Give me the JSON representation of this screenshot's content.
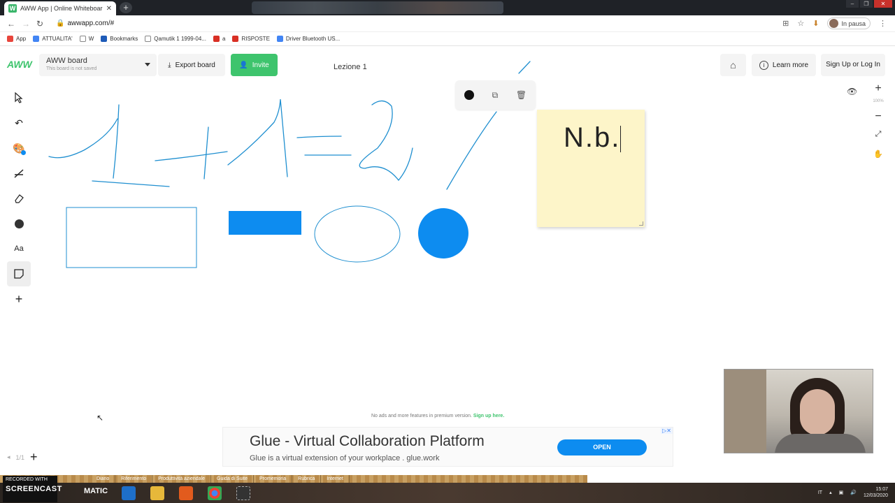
{
  "browser": {
    "tab_title": "AWW App | Online Whiteboard f",
    "url": "awwapp.com/#",
    "profile_label": "In pausa",
    "bookmarks": [
      {
        "label": "App",
        "color": "#e8453c"
      },
      {
        "label": "ATTUALITA'",
        "color": "#4285f4"
      },
      {
        "label": "W",
        "color": "#ffffff"
      },
      {
        "label": "Bookmarks",
        "color": "#1e5bb8"
      },
      {
        "label": "Qamutik 1 1999-04...",
        "color": "#ffffff"
      },
      {
        "label": "a",
        "color": "#d93025"
      },
      {
        "label": "RISPOSTE",
        "color": "#d93025"
      },
      {
        "label": "Driver Bluetooth US...",
        "color": "#4285f4"
      }
    ]
  },
  "header": {
    "logo": "AWW",
    "board_name": "AWW board",
    "board_status": "This board is not saved",
    "export_label": "Export board",
    "invite_label": "Invite",
    "board_title": "Lezione 1",
    "learn_more_label": "Learn more",
    "signup_label": "Sign Up or Log In"
  },
  "toolbar": {
    "text_tool": "Aa"
  },
  "zoom": {
    "level": "100%"
  },
  "sticky_note": {
    "text": "N.b."
  },
  "pager": {
    "label": "1/1"
  },
  "premium": {
    "text": "No ads and more features in premium version.",
    "link": "Sign up here."
  },
  "ad": {
    "headline": "Glue - Virtual Collaboration Platform",
    "subtext": "Glue is a virtual extension of your workplace . glue.work",
    "cta": "OPEN"
  },
  "taskbar": {
    "recorded_label": "RECORDED WITH",
    "screencast_label": "SCREENCAST",
    "matic_label": "MATIC",
    "strip_items": [
      "Diario",
      "Riferimento",
      "Produttività aziendale",
      "Guida di Suite",
      "Promemoria",
      "Rubrica",
      "Internet"
    ],
    "lang": "IT",
    "time": "15:07",
    "date": "12/03/2020"
  },
  "colors": {
    "accent": "#3ec46d",
    "shape_blue": "#0d8cf0",
    "stroke_blue": "#1f8fd0",
    "sticky": "#fdf5c9"
  }
}
